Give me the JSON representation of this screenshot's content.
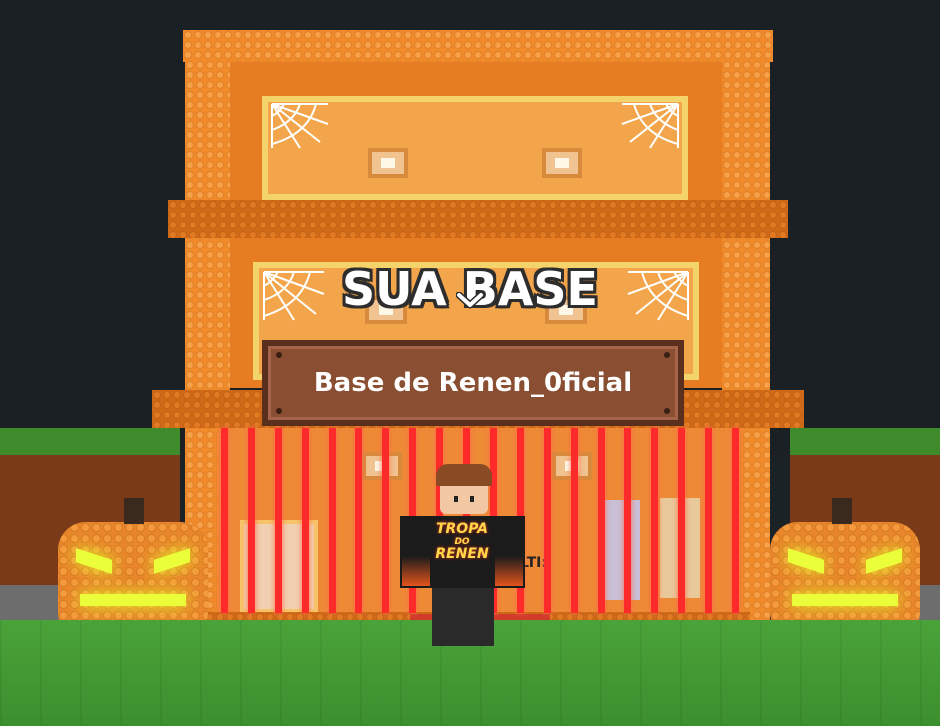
{
  "game": {
    "title_label": "SUA BASE",
    "sign_label": "Base de Renen_0ficial",
    "shirt_text_top": "TROPA",
    "shirt_text_mid": "DO",
    "shirt_text_bottom": "RENEN",
    "partial_label": "LTI:"
  },
  "icons": {
    "chevron": "chevron-down-icon"
  },
  "colors": {
    "building": "#f08a2a",
    "laser": "#ff2a2a",
    "sign_bg": "#8a4f33",
    "grass": "#4aa339",
    "sky": "#1a2024",
    "pumpkin_glow": "#eaff3a"
  }
}
